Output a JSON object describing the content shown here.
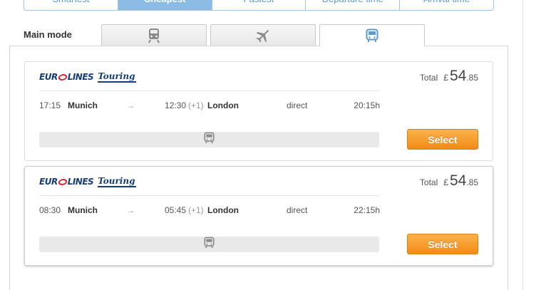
{
  "sort_tabs": [
    {
      "label": "Smartest",
      "active": false
    },
    {
      "label": "Cheapest",
      "active": true
    },
    {
      "label": "Fastest",
      "active": false
    },
    {
      "label": "Departure time",
      "active": false
    },
    {
      "label": "Arrival time",
      "active": false
    }
  ],
  "mode": {
    "label": "Main mode",
    "tabs": [
      {
        "icon": "train-icon",
        "active": false
      },
      {
        "icon": "plane-icon",
        "active": false
      },
      {
        "icon": "bus-icon",
        "active": true
      }
    ]
  },
  "results": [
    {
      "operator": {
        "euro": "EUR",
        "lines": "LINES",
        "touring": "Touring"
      },
      "price": {
        "label": "Total",
        "currency": "£",
        "whole": "54",
        "decimal": ".85"
      },
      "departure_time": "17:15",
      "departure_city": "Munich",
      "arrow": "→",
      "arrival_time": "12:30",
      "day_offset": "(+1)",
      "arrival_city": "London",
      "transfers": "direct",
      "duration": "20:15h",
      "segment_icon": "bus-icon",
      "select_label": "Select"
    },
    {
      "operator": {
        "euro": "EUR",
        "lines": "LINES",
        "touring": "Touring"
      },
      "price": {
        "label": "Total",
        "currency": "£",
        "whole": "54",
        "decimal": ".85"
      },
      "departure_time": "08:30",
      "departure_city": "Munich",
      "arrow": "→",
      "arrival_time": "05:45",
      "day_offset": "(+1)",
      "arrival_city": "London",
      "transfers": "direct",
      "duration": "22:15h",
      "segment_icon": "bus-icon",
      "select_label": "Select"
    }
  ],
  "colors": {
    "accent_blue": "#8cbce6",
    "select_orange": "#f28b16",
    "operator_navy": "#163d7a",
    "operator_red": "#d7262f"
  }
}
